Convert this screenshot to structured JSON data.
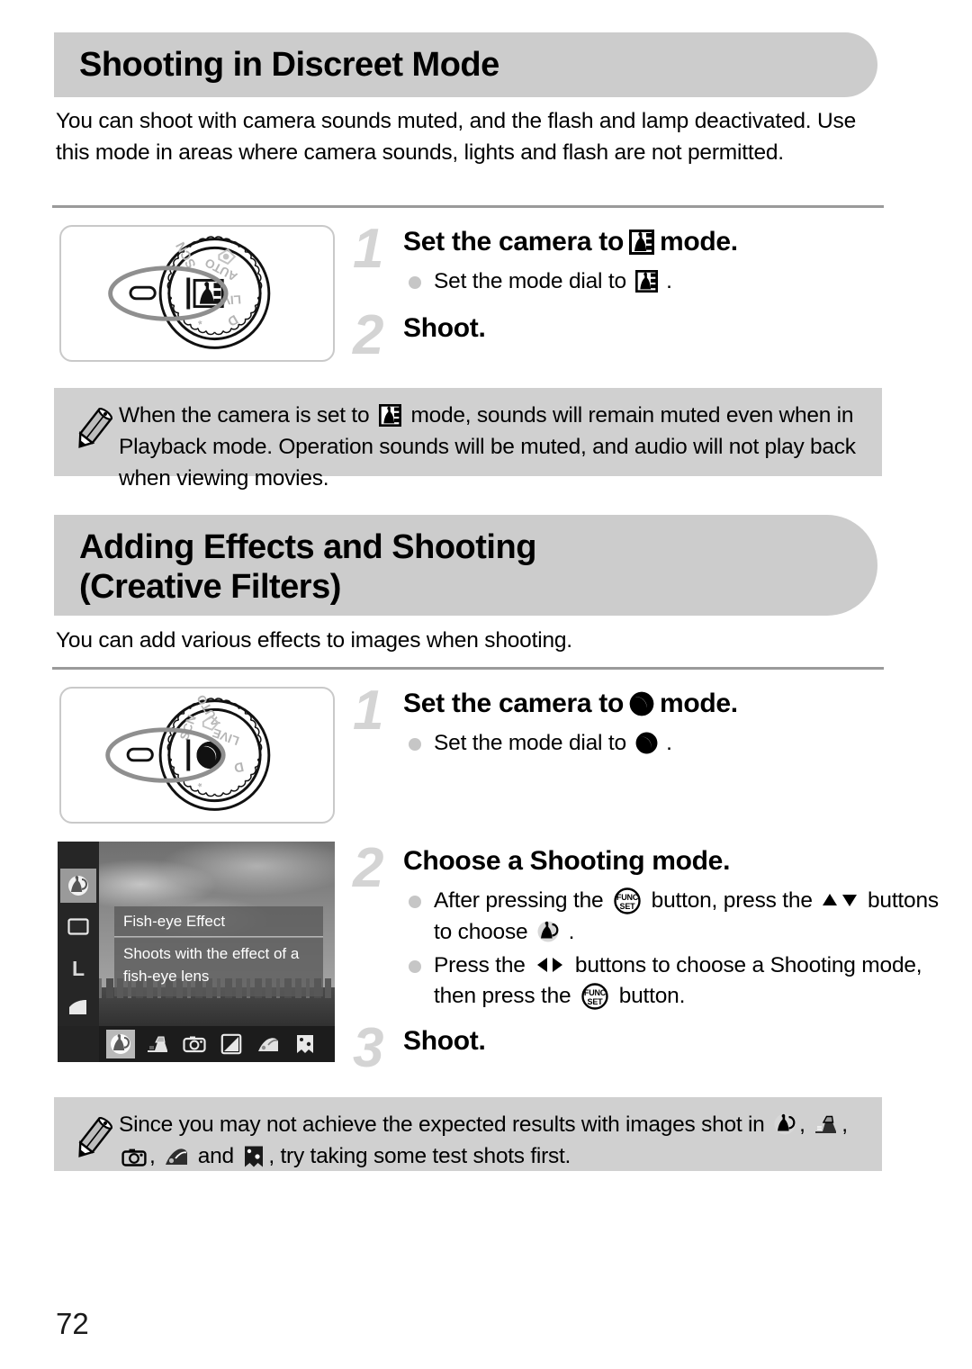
{
  "page": {
    "number": "72"
  },
  "sections": [
    {
      "heading": "Shooting in Discreet Mode",
      "intro": "You can shoot with camera sounds muted, and the flash and lamp deactivated. Use this mode in areas where camera sounds, lights and flash are not permitted.",
      "steps": [
        {
          "number": "1",
          "head_before": "Set the camera to",
          "head_icon": "discreet-mode-icon",
          "head_after": "mode.",
          "bullets": [
            {
              "before": "Set the mode dial to",
              "icon": "discreet-mode-icon",
              "after": "."
            }
          ]
        },
        {
          "number": "2",
          "head_before": "Shoot.",
          "head_icon": "",
          "head_after": "",
          "bullets": []
        }
      ],
      "note": {
        "icon": "pencil-icon",
        "part1": "When the camera is set to",
        "icon_inline": "discreet-mode-icon",
        "part2": "mode, sounds will remain muted even when in Playback mode. Operation sounds will be muted, and audio will not play back when viewing movies."
      }
    },
    {
      "heading_line1": "Adding Effects and Shooting",
      "heading_line2": "(Creative Filters)",
      "intro": "You can add various effects to images when shooting.",
      "steps": [
        {
          "number": "1",
          "head_before": "Set the camera to",
          "head_icon": "creative-filters-icon",
          "head_after": "mode.",
          "bullets": [
            {
              "before": "Set the mode dial to",
              "icon": "creative-filters-icon",
              "after": "."
            }
          ]
        },
        {
          "number": "2",
          "head_before": "Choose a Shooting mode.",
          "head_icon": "",
          "head_after": "",
          "bullets": [
            {
              "seg1": "After pressing the",
              "icon1": "func-set-button-icon",
              "seg2": "button, press the",
              "icon2": "up-down-buttons-icon",
              "seg3": "buttons to choose",
              "icon3": "fish-eye-icon",
              "seg4": "."
            },
            {
              "seg1": "Press the",
              "icon1": "left-right-buttons-icon",
              "seg2": "buttons to choose a Shooting mode, then press the",
              "icon2": "func-set-button-icon",
              "seg3": "button."
            }
          ]
        },
        {
          "number": "3",
          "head_before": "Shoot.",
          "head_icon": "",
          "head_after": "",
          "bullets": []
        }
      ],
      "note": {
        "icon": "pencil-icon",
        "part1": "Since you may not achieve the expected results with images shot in",
        "icons": [
          "fish-eye-icon",
          "miniature-icon",
          "toy-camera-icon",
          "monochrome-icon",
          "super-vivid-icon",
          "poster-effect-icon"
        ],
        "separator1": ",",
        "part_and": "and",
        "part2": ", try taking some test shots first."
      }
    }
  ],
  "mode_dial_1": {
    "labels": [
      "SCN",
      "AUTO",
      "LIVE"
    ],
    "selected_icon": "discreet-mode-icon",
    "indicator": "dial-index-mark"
  },
  "mode_dial_2": {
    "labels": [
      "SCN",
      "AUTO",
      "LIVE"
    ],
    "selected_icon": "creative-filters-icon",
    "indicator": "dial-index-mark"
  },
  "lcd_screen": {
    "panel_title": "Fish-eye Effect",
    "panel_desc_line1": "Shoots with the effect of a",
    "panel_desc_line2": "fish-eye lens",
    "sidebar_items": [
      {
        "name": "fish-eye-icon",
        "label": "",
        "selected": true
      },
      {
        "name": "aspect-ratio-icon",
        "label": "",
        "selected": false
      },
      {
        "name": "image-size-icon",
        "label": "L",
        "selected": false
      },
      {
        "name": "compression-icon",
        "label": "",
        "selected": false
      }
    ],
    "toolbar_items": [
      {
        "name": "fish-eye-icon",
        "selected": true
      },
      {
        "name": "miniature-icon",
        "selected": false
      },
      {
        "name": "toy-camera-icon",
        "selected": false
      },
      {
        "name": "monochrome-icon",
        "selected": false
      },
      {
        "name": "super-vivid-icon",
        "selected": false
      },
      {
        "name": "poster-effect-icon",
        "selected": false
      }
    ]
  },
  "colors": {
    "heading_bar": "#cccccc",
    "note_bg": "#d0d0d0",
    "step_number": "#d4d4d4",
    "rule": "#9a9a9a",
    "bullet": "#c6c6c6"
  }
}
